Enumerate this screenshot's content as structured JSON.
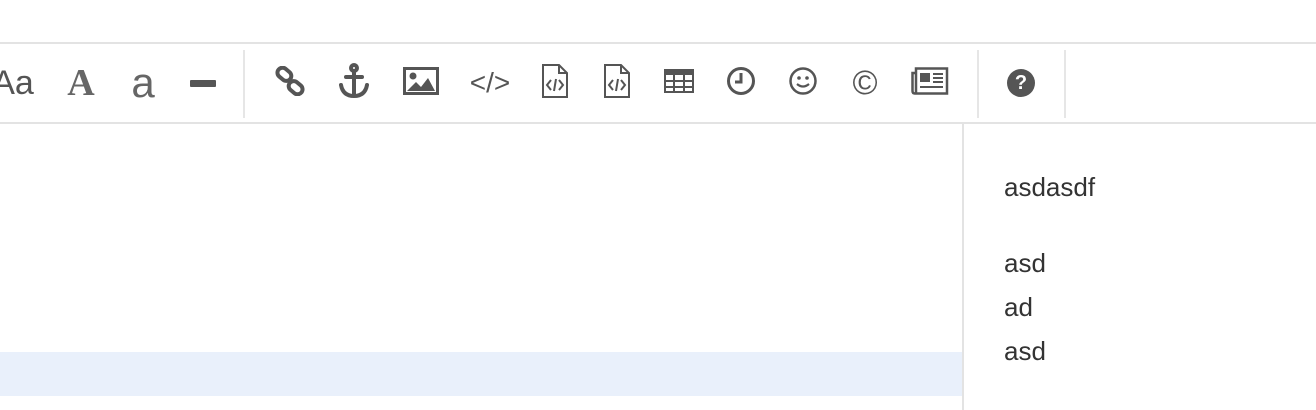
{
  "toolbar": {
    "groups": [
      {
        "buttons": [
          {
            "name": "font-size-icon",
            "text": "Aa"
          },
          {
            "name": "font-serif-icon",
            "text": "A"
          },
          {
            "name": "font-sans-icon",
            "text": "a"
          },
          {
            "name": "horizontal-rule-icon",
            "text": ""
          }
        ]
      },
      {
        "buttons": [
          {
            "name": "link-icon"
          },
          {
            "name": "anchor-icon"
          },
          {
            "name": "image-icon"
          },
          {
            "name": "code-icon",
            "text": "</>"
          },
          {
            "name": "code-file-icon"
          },
          {
            "name": "code-file-alt-icon"
          },
          {
            "name": "table-icon"
          },
          {
            "name": "clock-icon"
          },
          {
            "name": "emoji-icon"
          },
          {
            "name": "copyright-icon",
            "text": "©"
          },
          {
            "name": "newspaper-icon"
          }
        ]
      },
      {
        "buttons": [
          {
            "name": "help-icon",
            "text": "?"
          }
        ]
      }
    ]
  },
  "preview": {
    "lines": [
      "asdasdf",
      "asd",
      "ad",
      "asd"
    ]
  },
  "colors": {
    "icon": "#555555",
    "highlight_row": "#e9f0fb",
    "border": "#e3e3e3"
  }
}
